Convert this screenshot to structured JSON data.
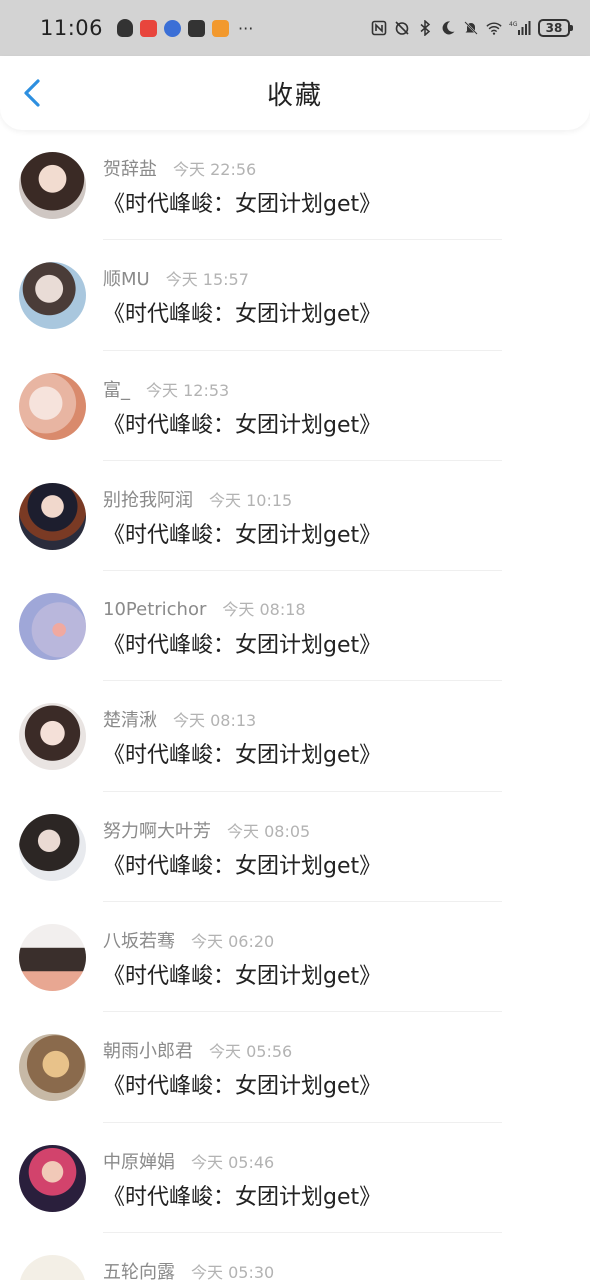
{
  "status_bar": {
    "time": "11:06",
    "more": "···",
    "battery": "38",
    "network": "4G"
  },
  "header": {
    "title": "收藏",
    "back_icon": "chevron-left-icon"
  },
  "accent_color": "#2d8fe0",
  "items": [
    {
      "name": "贺辞盐",
      "time": "今天 22:56",
      "work": "《时代峰峻：女团计划get》"
    },
    {
      "name": "顺MU",
      "time": "今天 15:57",
      "work": "《时代峰峻：女团计划get》"
    },
    {
      "name": "富_",
      "time": "今天 12:53",
      "work": "《时代峰峻：女团计划get》"
    },
    {
      "name": "别抢我阿润",
      "time": "今天 10:15",
      "work": "《时代峰峻：女团计划get》"
    },
    {
      "name": "10Petrichor",
      "time": "今天 08:18",
      "work": "《时代峰峻：女团计划get》"
    },
    {
      "name": "楚清湫",
      "time": "今天 08:13",
      "work": "《时代峰峻：女团计划get》"
    },
    {
      "name": "努力啊大叶芳",
      "time": "今天 08:05",
      "work": "《时代峰峻：女团计划get》"
    },
    {
      "name": "八坂若骞",
      "time": "今天 06:20",
      "work": "《时代峰峻：女团计划get》"
    },
    {
      "name": "朝雨小郎君",
      "time": "今天 05:56",
      "work": "《时代峰峻：女团计划get》"
    },
    {
      "name": "中原婵娟",
      "time": "今天 05:46",
      "work": "《时代峰峻：女团计划get》"
    },
    {
      "name": "五轮向露",
      "time": "今天 05:30",
      "work": ""
    }
  ]
}
